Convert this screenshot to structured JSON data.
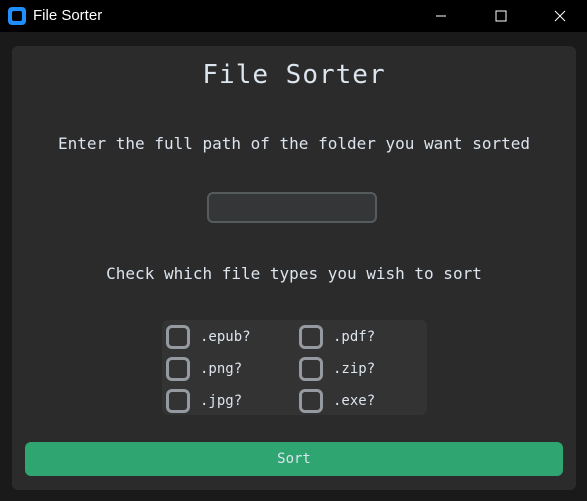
{
  "window": {
    "title": "File Sorter",
    "icon": "app-icon",
    "controls": [
      "minimize-icon",
      "maximize-icon",
      "close-icon"
    ]
  },
  "main": {
    "heading": "File Sorter",
    "path_prompt": "Enter the full path of the folder you want sorted",
    "path_value": "",
    "path_placeholder": "",
    "types_prompt": "Check which file types you wish to sort",
    "file_types": [
      {
        "label": ".epub?",
        "checked": false
      },
      {
        "label": ".pdf?",
        "checked": false
      },
      {
        "label": ".png?",
        "checked": false
      },
      {
        "label": ".zip?",
        "checked": false
      },
      {
        "label": ".jpg?",
        "checked": false
      },
      {
        "label": ".exe?",
        "checked": false
      }
    ],
    "sort_label": "Sort"
  },
  "colors": {
    "accent": "#2fa572",
    "titlebar": "#000000",
    "frame": "#2b2b2b",
    "text": "#dce4ee",
    "checkbox_border": "#949a9f"
  }
}
